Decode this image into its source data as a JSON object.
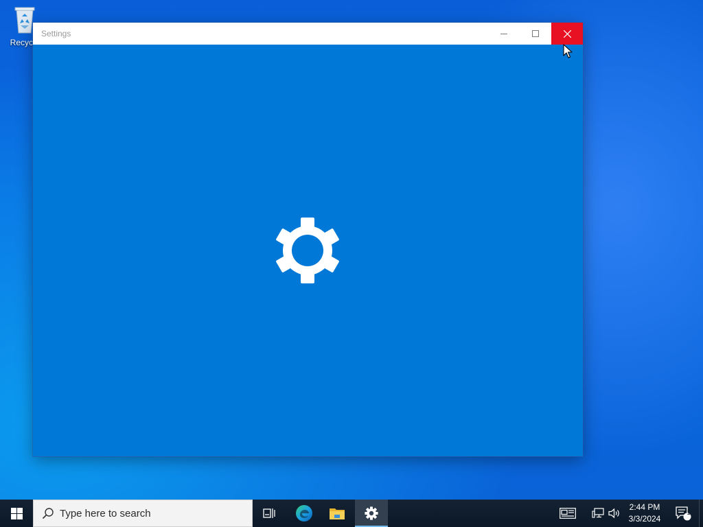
{
  "desktop": {
    "recycle_bin_label": "Recycle"
  },
  "window": {
    "title": "Settings",
    "minimize_icon": "minimize-icon",
    "maximize_icon": "maximize-icon",
    "close_icon": "close-icon",
    "splash_icon": "gear-icon",
    "background_color": "#0078d7",
    "close_hover_color": "#e81123"
  },
  "taskbar": {
    "start_icon": "windows-logo-icon",
    "search_placeholder": "Type here to search",
    "apps": [
      "task-view",
      "microsoft-edge",
      "file-explorer",
      "settings"
    ],
    "active_app": "settings",
    "tray": {
      "time": "2:44 PM",
      "date": "3/3/2024",
      "notification_count": "1"
    }
  }
}
